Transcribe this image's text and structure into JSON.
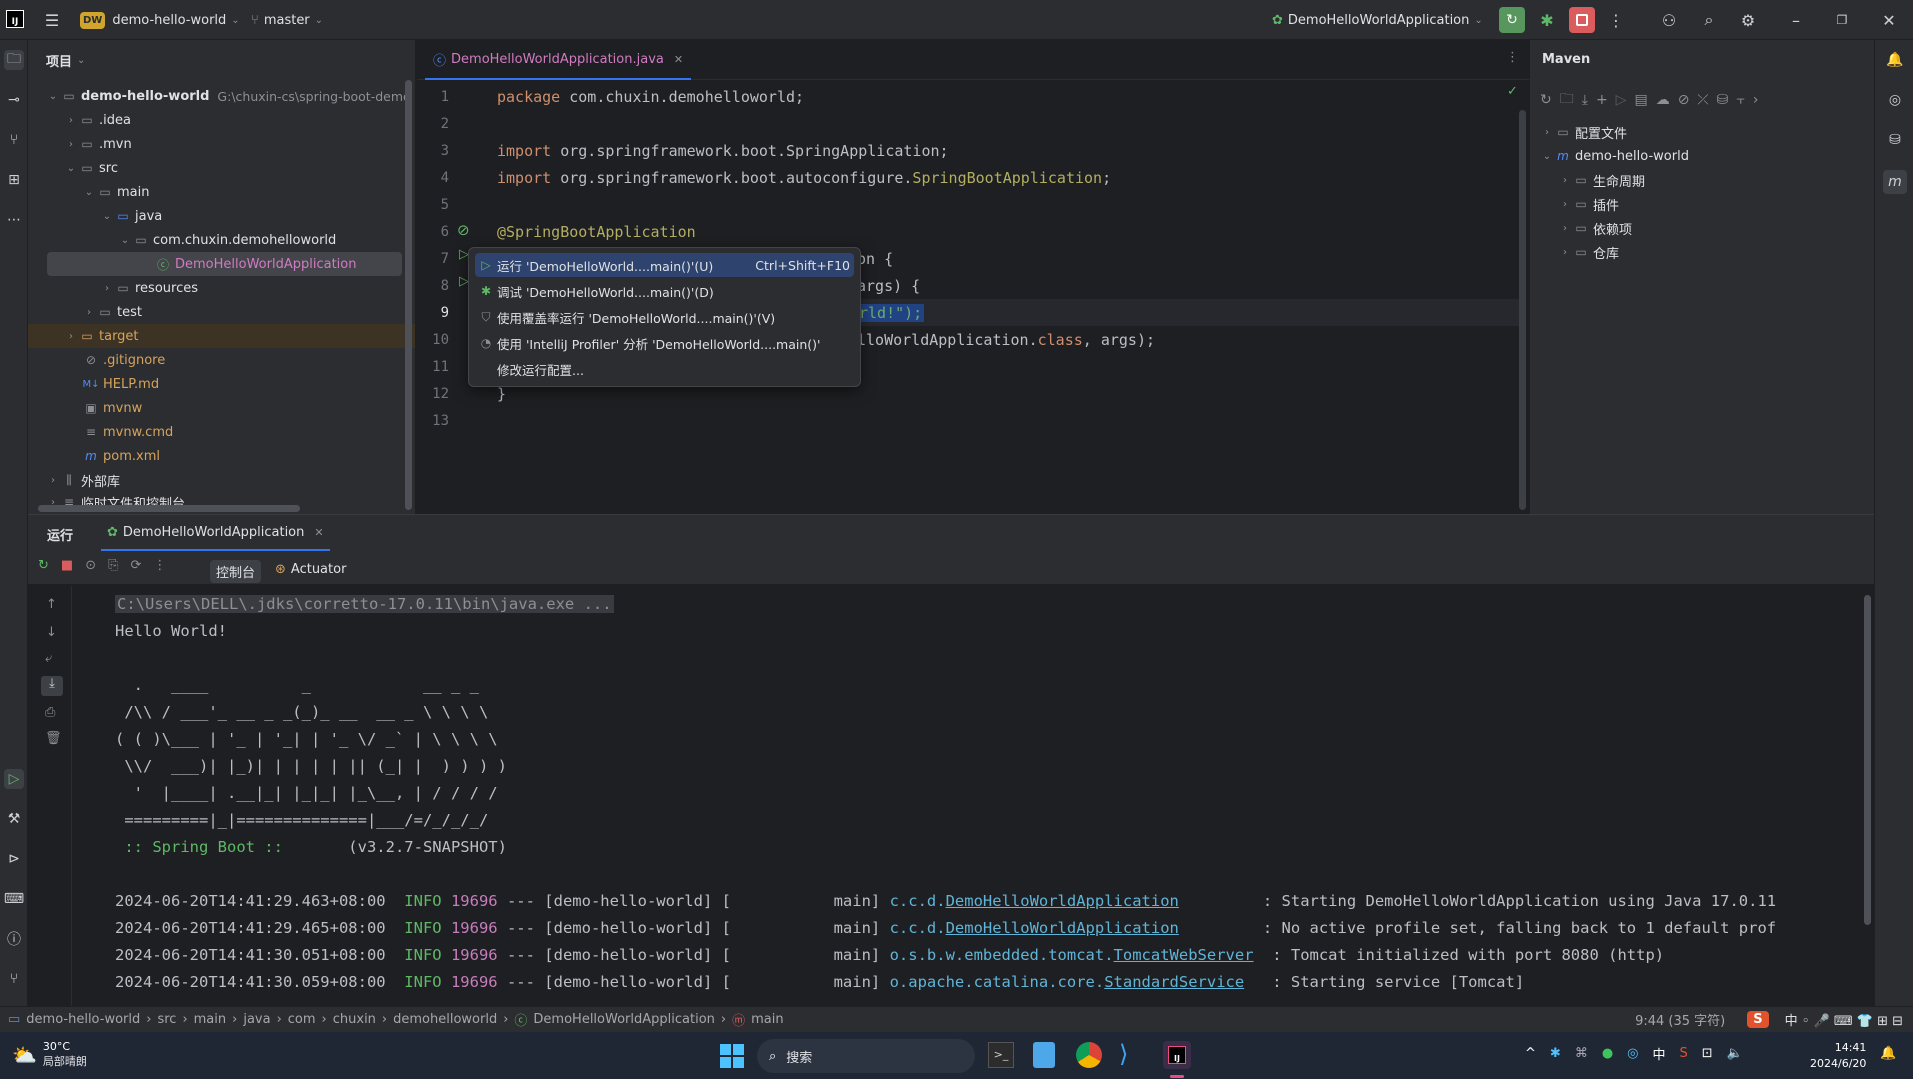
{
  "titlebar": {
    "project_badge": "DW",
    "project_name": "demo-hello-world",
    "branch": "master",
    "run_config": "DemoHelloWorldApplication"
  },
  "project_panel": {
    "title": "项目",
    "root_name": "demo-hello-world",
    "root_path": "G:\\chuxin-cs\\spring-boot-demo",
    "items": [
      {
        "label": ".idea"
      },
      {
        "label": ".mvn"
      },
      {
        "label": "src"
      },
      {
        "label": "main"
      },
      {
        "label": "java"
      },
      {
        "label": "com.chuxin.demohelloworld"
      },
      {
        "label": "DemoHelloWorldApplication"
      },
      {
        "label": "resources"
      },
      {
        "label": "test"
      },
      {
        "label": "target"
      },
      {
        "label": ".gitignore"
      },
      {
        "label": "HELP.md"
      },
      {
        "label": "mvnw"
      },
      {
        "label": "mvnw.cmd"
      },
      {
        "label": "pom.xml"
      },
      {
        "label": "外部库"
      },
      {
        "label": "临时文件和控制台"
      }
    ]
  },
  "editor": {
    "tab": "DemoHelloWorldApplication.java",
    "line_numbers": [
      "1",
      "2",
      "3",
      "4",
      "5",
      "6",
      "7",
      "8",
      "9",
      "10",
      "11",
      "12",
      "13"
    ],
    "l1_kw": "package",
    "l1_rest": " com.chuxin.demohelloworld;",
    "l3_kw": "import",
    "l3_rest": " org.springframework.boot.SpringApplication;",
    "l4_kw": "import",
    "l4_rest": " org.springframework.boot.autoconfigure.",
    "l4_ann": "SpringBootApplication",
    "l4_end": ";",
    "l6": "@SpringBootApplication",
    "l7": "on {",
    "l8": "args) {",
    "l9": "rld!\");",
    "l10_a": "lloWorldApplication.",
    "l10_kw": "class",
    "l10_b": ", args);",
    "l12": "}"
  },
  "context_menu": {
    "items": [
      {
        "label": "运行 'DemoHelloWorld....main()'(U)",
        "shortcut": "Ctrl+Shift+F10"
      },
      {
        "label": "调试 'DemoHelloWorld....main()'(D)",
        "shortcut": ""
      },
      {
        "label": "使用覆盖率运行 'DemoHelloWorld....main()'(V)",
        "shortcut": ""
      },
      {
        "label": "使用 'IntelliJ Profiler' 分析 'DemoHelloWorld....main()'",
        "shortcut": ""
      },
      {
        "label": "修改运行配置...",
        "shortcut": ""
      }
    ]
  },
  "maven": {
    "title": "Maven",
    "items": [
      {
        "label": "配置文件"
      },
      {
        "label": "demo-hello-world"
      },
      {
        "label": "生命周期"
      },
      {
        "label": "插件"
      },
      {
        "label": "依赖项"
      },
      {
        "label": "仓库"
      }
    ]
  },
  "run_panel": {
    "title": "运行",
    "tab": "DemoHelloWorldApplication",
    "console_tab": "控制台",
    "actuator_tab": "Actuator",
    "cmd": "C:\\Users\\DELL\\.jdks\\corretto-17.0.11\\bin\\java.exe ...",
    "hello": "Hello World!",
    "banner": [
      "  .   ____          _            __ _ _",
      " /\\\\ / ___'_ __ _ _(_)_ __  __ _ \\ \\ \\ \\",
      "( ( )\\___ | '_ | '_| | '_ \\/ _` | \\ \\ \\ \\",
      " \\\\/  ___)| |_)| | | | | || (_| |  ) ) ) )",
      "  '  |____| .__|_| |_|_| |_\\__, | / / / /",
      " =========|_|==============|___/=/_/_/_/"
    ],
    "spring_label": " :: Spring Boot :: ",
    "spring_version": "      (v3.2.7-SNAPSHOT)",
    "logs": [
      {
        "ts": "2024-06-20T14:41:29.463+08:00",
        "level": "INFO",
        "pid": "19696",
        "mid": " --- [demo-hello-world] [           main] ",
        "pkg": "c.c.d.",
        "cls": "DemoHelloWorldApplication",
        "msg": "         : Starting DemoHelloWorldApplication using Java 17.0.11"
      },
      {
        "ts": "2024-06-20T14:41:29.465+08:00",
        "level": "INFO",
        "pid": "19696",
        "mid": " --- [demo-hello-world] [           main] ",
        "pkg": "c.c.d.",
        "cls": "DemoHelloWorldApplication",
        "msg": "         : No active profile set, falling back to 1 default prof"
      },
      {
        "ts": "2024-06-20T14:41:30.051+08:00",
        "level": "INFO",
        "pid": "19696",
        "mid": " --- [demo-hello-world] [           main] ",
        "pkg": "o.s.b.w.embedded.tomcat.",
        "cls": "TomcatWebServer",
        "msg": "  : Tomcat initialized with port 8080 (http)"
      },
      {
        "ts": "2024-06-20T14:41:30.059+08:00",
        "level": "INFO",
        "pid": "19696",
        "mid": " --- [demo-hello-world] [           main] ",
        "pkg": "o.apache.catalina.core.",
        "cls": "StandardService",
        "msg": "   : Starting service [Tomcat]"
      }
    ]
  },
  "statusbar": {
    "crumbs": [
      "demo-hello-world",
      "src",
      "main",
      "java",
      "com",
      "chuxin",
      "demohelloworld",
      "DemoHelloWorldApplication",
      "main"
    ],
    "position": "9:44 (35 字符)"
  },
  "taskbar": {
    "weather_temp": "30°C",
    "weather_desc": "局部晴朗",
    "search": "搜索",
    "ime": "中",
    "time": "14:41",
    "date": "2024/6/20"
  },
  "colors": {
    "accent": "#3574f0",
    "run_green": "#5fb865",
    "stop_red": "#db5c5c"
  }
}
